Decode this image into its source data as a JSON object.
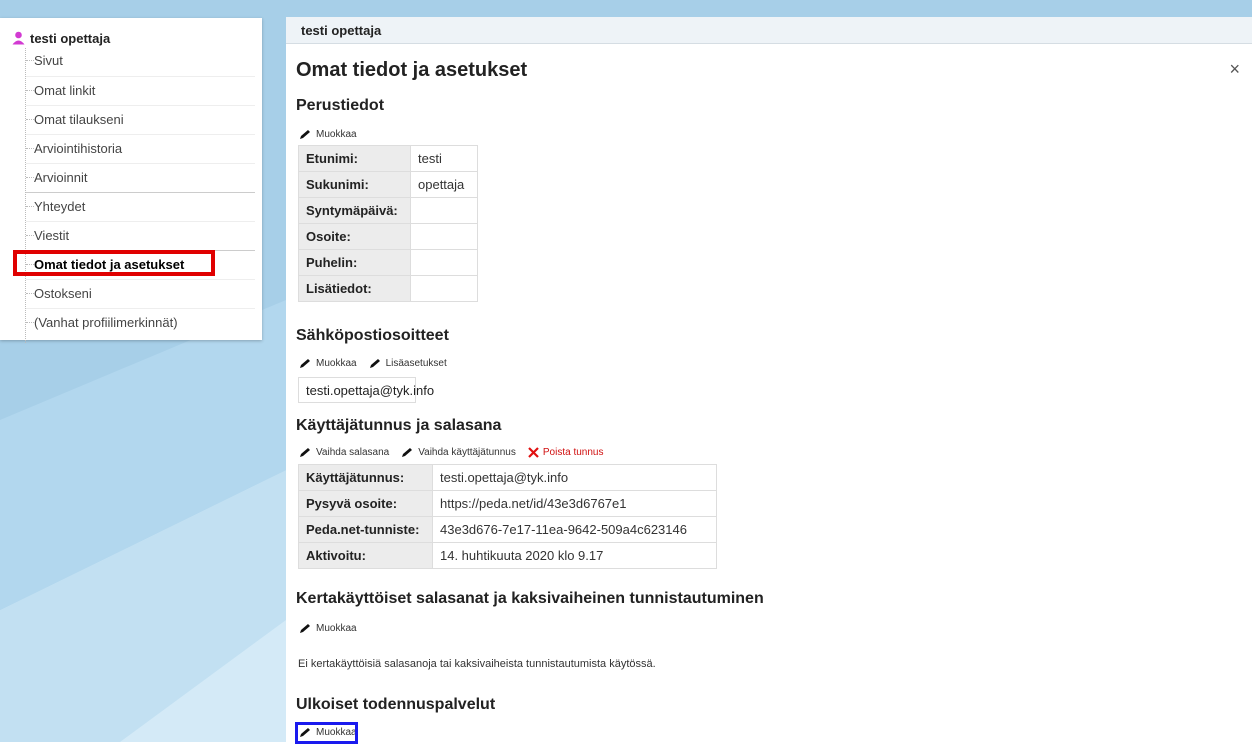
{
  "sidebar": {
    "user_name": "testi opettaja",
    "items": [
      {
        "label": "Sivut"
      },
      {
        "label": "Omat linkit"
      },
      {
        "label": "Omat tilaukseni"
      },
      {
        "label": "Arviointihistoria"
      },
      {
        "label": "Arvioinnit"
      },
      {
        "label": "Yhteydet"
      },
      {
        "label": "Viestit"
      },
      {
        "label": "Omat tiedot ja asetukset",
        "active": true
      },
      {
        "label": "Ostokseni"
      },
      {
        "label": "(Vanhat profiilimerkinnät)"
      }
    ]
  },
  "header": {
    "title": "testi opettaja"
  },
  "page": {
    "title": "Omat tiedot ja asetukset",
    "close": "×"
  },
  "basic": {
    "heading": "Perustiedot",
    "edit": "Muokkaa",
    "rows": [
      {
        "k": "Etunimi:",
        "v": "testi"
      },
      {
        "k": "Sukunimi:",
        "v": "opettaja"
      },
      {
        "k": "Syntymäpäivä:",
        "v": ""
      },
      {
        "k": "Osoite:",
        "v": ""
      },
      {
        "k": "Puhelin:",
        "v": ""
      },
      {
        "k": "Lisätiedot:",
        "v": ""
      }
    ]
  },
  "email": {
    "heading": "Sähköpostiosoitteet",
    "edit": "Muokkaa",
    "extra": "Lisäasetukset",
    "address": "testi.opettaja@tyk.info"
  },
  "account": {
    "heading": "Käyttäjätunnus ja salasana",
    "change_password": "Vaihda salasana",
    "change_username": "Vaihda käyttäjätunnus",
    "delete": "Poista tunnus",
    "rows": [
      {
        "k": "Käyttäjätunnus:",
        "v": "testi.opettaja@tyk.info"
      },
      {
        "k": "Pysyvä osoite:",
        "v": "https://peda.net/id/43e3d6767e1"
      },
      {
        "k": "Peda.net-tunniste:",
        "v": "43e3d676-7e17-11ea-9642-509a4c623146"
      },
      {
        "k": "Aktivoitu:",
        "v": "14. huhtikuuta 2020 klo 9.17"
      }
    ]
  },
  "otp": {
    "heading": "Kertakäyttöiset salasanat ja kaksivaiheinen tunnistautuminen",
    "edit": "Muokkaa",
    "note": "Ei kertakäyttöisiä salasanoja tai kaksivaiheista tunnistautumista käytössä."
  },
  "external": {
    "heading": "Ulkoiset todennuspalvelut",
    "edit": "Muokkaa"
  },
  "colors": {
    "highlight_red": "#e00000",
    "highlight_blue": "#1a1aee",
    "delete_red": "#d01010"
  }
}
